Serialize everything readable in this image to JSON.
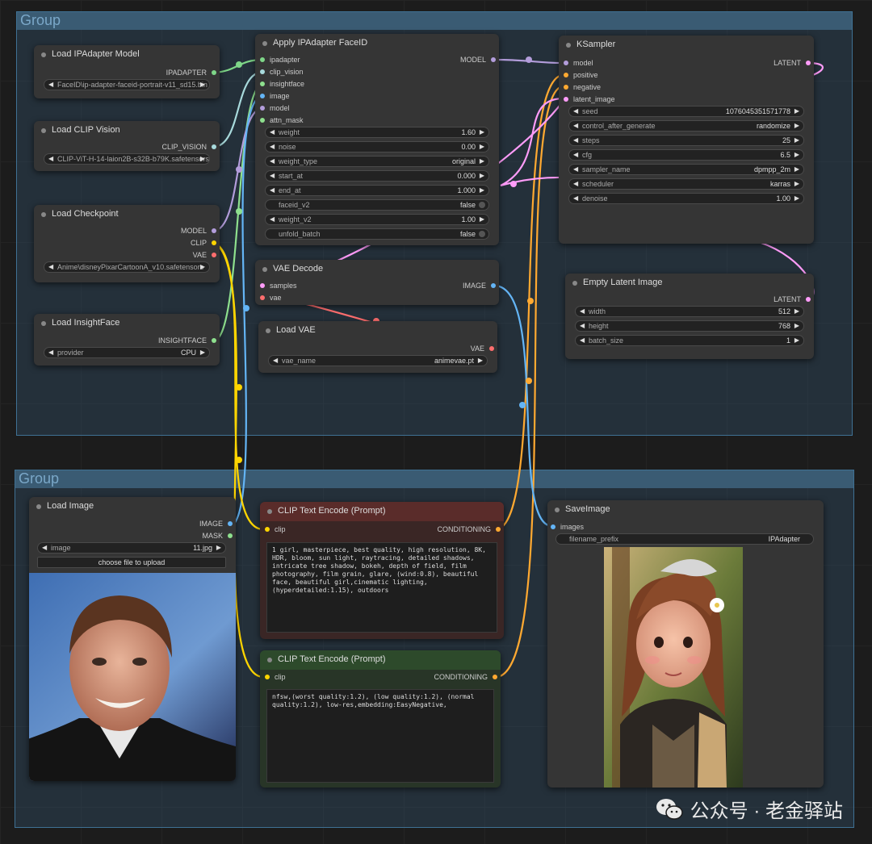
{
  "groups": [
    {
      "title": "Group"
    },
    {
      "title": "Group"
    }
  ],
  "nodes": {
    "load_ipadapter": {
      "title": "Load IPAdapter Model",
      "out_ipadapter": "IPADAPTER",
      "model_value": "FaceID\\ip-adapter-faceid-portrait-v11_sd15.bin"
    },
    "load_clip_vision": {
      "title": "Load CLIP Vision",
      "out_clip_vision": "CLIP_VISION",
      "model_value": "CLIP-ViT-H-14-laion2B-s32B-b79K.safetensors"
    },
    "load_checkpoint": {
      "title": "Load Checkpoint",
      "out_model": "MODEL",
      "out_clip": "CLIP",
      "out_vae": "VAE",
      "ckpt_value": "Anime\\disneyPixarCartoonA_v10.safetensors"
    },
    "load_insightface": {
      "title": "Load InsightFace",
      "out_insightface": "INSIGHTFACE",
      "provider_label": "provider",
      "provider_value": "CPU"
    },
    "apply_ipadapter": {
      "title": "Apply IPAdapter FaceID",
      "in_ipadapter": "ipadapter",
      "in_clip_vision": "clip_vision",
      "in_insightface": "insightface",
      "in_image": "image",
      "in_model": "model",
      "in_attn_mask": "attn_mask",
      "out_model": "MODEL",
      "widgets": [
        {
          "label": "weight",
          "value": "1.60"
        },
        {
          "label": "noise",
          "value": "0.00"
        },
        {
          "label": "weight_type",
          "value": "original"
        },
        {
          "label": "start_at",
          "value": "0.000"
        },
        {
          "label": "end_at",
          "value": "1.000"
        },
        {
          "label": "faceid_v2",
          "value": "false"
        },
        {
          "label": "weight_v2",
          "value": "1.00"
        },
        {
          "label": "unfold_batch",
          "value": "false"
        }
      ]
    },
    "vae_decode": {
      "title": "VAE Decode",
      "in_samples": "samples",
      "in_vae": "vae",
      "out_image": "IMAGE"
    },
    "load_vae": {
      "title": "Load VAE",
      "out_vae": "VAE",
      "vae_label": "vae_name",
      "vae_value": "animevae.pt"
    },
    "ksampler": {
      "title": "KSampler",
      "in_model": "model",
      "in_positive": "positive",
      "in_negative": "negative",
      "in_latent": "latent_image",
      "out_latent": "LATENT",
      "widgets": [
        {
          "label": "seed",
          "value": "1076045351571778"
        },
        {
          "label": "control_after_generate",
          "value": "randomize"
        },
        {
          "label": "steps",
          "value": "25"
        },
        {
          "label": "cfg",
          "value": "6.5"
        },
        {
          "label": "sampler_name",
          "value": "dpmpp_2m"
        },
        {
          "label": "scheduler",
          "value": "karras"
        },
        {
          "label": "denoise",
          "value": "1.00"
        }
      ]
    },
    "empty_latent": {
      "title": "Empty Latent Image",
      "out_latent": "LATENT",
      "widgets": [
        {
          "label": "width",
          "value": "512"
        },
        {
          "label": "height",
          "value": "768"
        },
        {
          "label": "batch_size",
          "value": "1"
        }
      ]
    },
    "load_image": {
      "title": "Load Image",
      "out_image": "IMAGE",
      "out_mask": "MASK",
      "image_label": "image",
      "image_value": "11.jpg",
      "upload_label": "choose file to upload"
    },
    "clip_pos": {
      "title": "CLIP Text Encode (Prompt)",
      "in_clip": "clip",
      "out_conditioning": "CONDITIONING",
      "text": "1 girl, masterpiece, best quality, high resolution, 8K, HDR, bloom, sun light, raytracing, detailed shadows, intricate tree shadow, bokeh, depth of field, film photography, film grain, glare, (wind:0.8), beautiful face, beautiful girl,cinematic lighting, (hyperdetailed:1.15), outdoors"
    },
    "clip_neg": {
      "title": "CLIP Text Encode (Prompt)",
      "in_clip": "clip",
      "out_conditioning": "CONDITIONING",
      "text": "nfsw,(worst quality:1.2), (low quality:1.2), (normal quality:1.2), low-res,embedding:EasyNegative,"
    },
    "save_image": {
      "title": "SaveImage",
      "in_images": "images",
      "prefix_label": "filename_prefix",
      "prefix_value": "IPAdapter"
    }
  },
  "watermark": {
    "text": "公众号 · 老金驿站",
    "icon": "wechat-icon"
  },
  "colors": {
    "model": "#b39ddb",
    "clip": "#ffd500",
    "vae": "#ff6e6e",
    "image": "#64b5f6",
    "conditioning": "#ffa931",
    "latent": "#ff9cf9",
    "ipadapter": "#7ed688",
    "clip_vision": "#a8dadc",
    "insightface": "#8ee08e"
  }
}
